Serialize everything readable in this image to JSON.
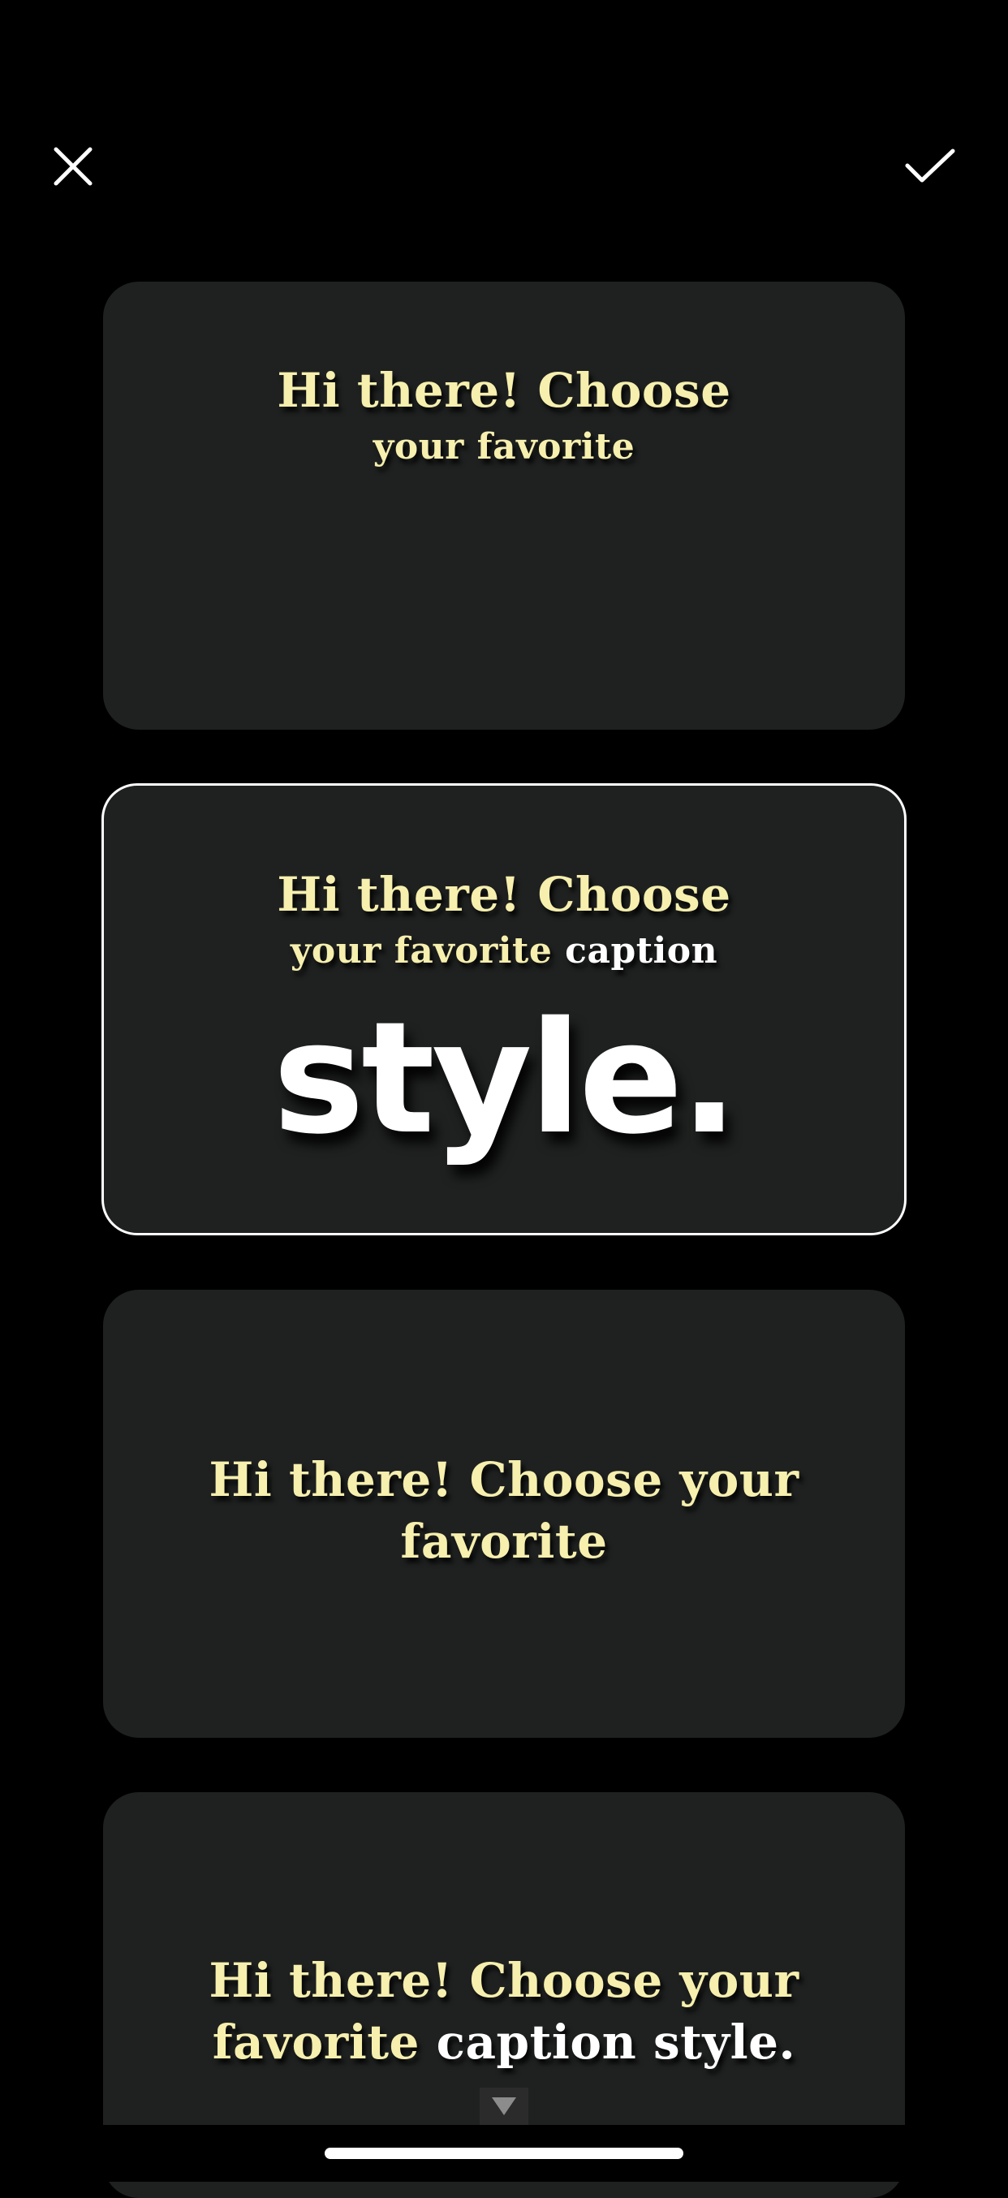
{
  "toolbar": {
    "close_icon": "close-icon",
    "confirm_icon": "checkmark-icon"
  },
  "styles": [
    {
      "line1": "Hi there! Choose",
      "line2": "your favorite",
      "selected": false
    },
    {
      "line1": "Hi there! Choose",
      "line2_yellow": "your favorite",
      "line2_white": "caption",
      "big_word": "style.",
      "selected": true
    },
    {
      "line1": "Hi there! Choose your",
      "line2": "favorite",
      "selected": false
    },
    {
      "line1": "Hi there! Choose your",
      "line2_yellow": "favorite",
      "line2_white": "caption style.",
      "selected": false
    }
  ],
  "scroll_indicator_icon": "triangle-down-icon",
  "colors": {
    "background": "#000000",
    "card": "#1f2120",
    "caption_yellow": "#f6efae",
    "caption_white": "#ffffff",
    "selection_border": "#ffffff"
  }
}
